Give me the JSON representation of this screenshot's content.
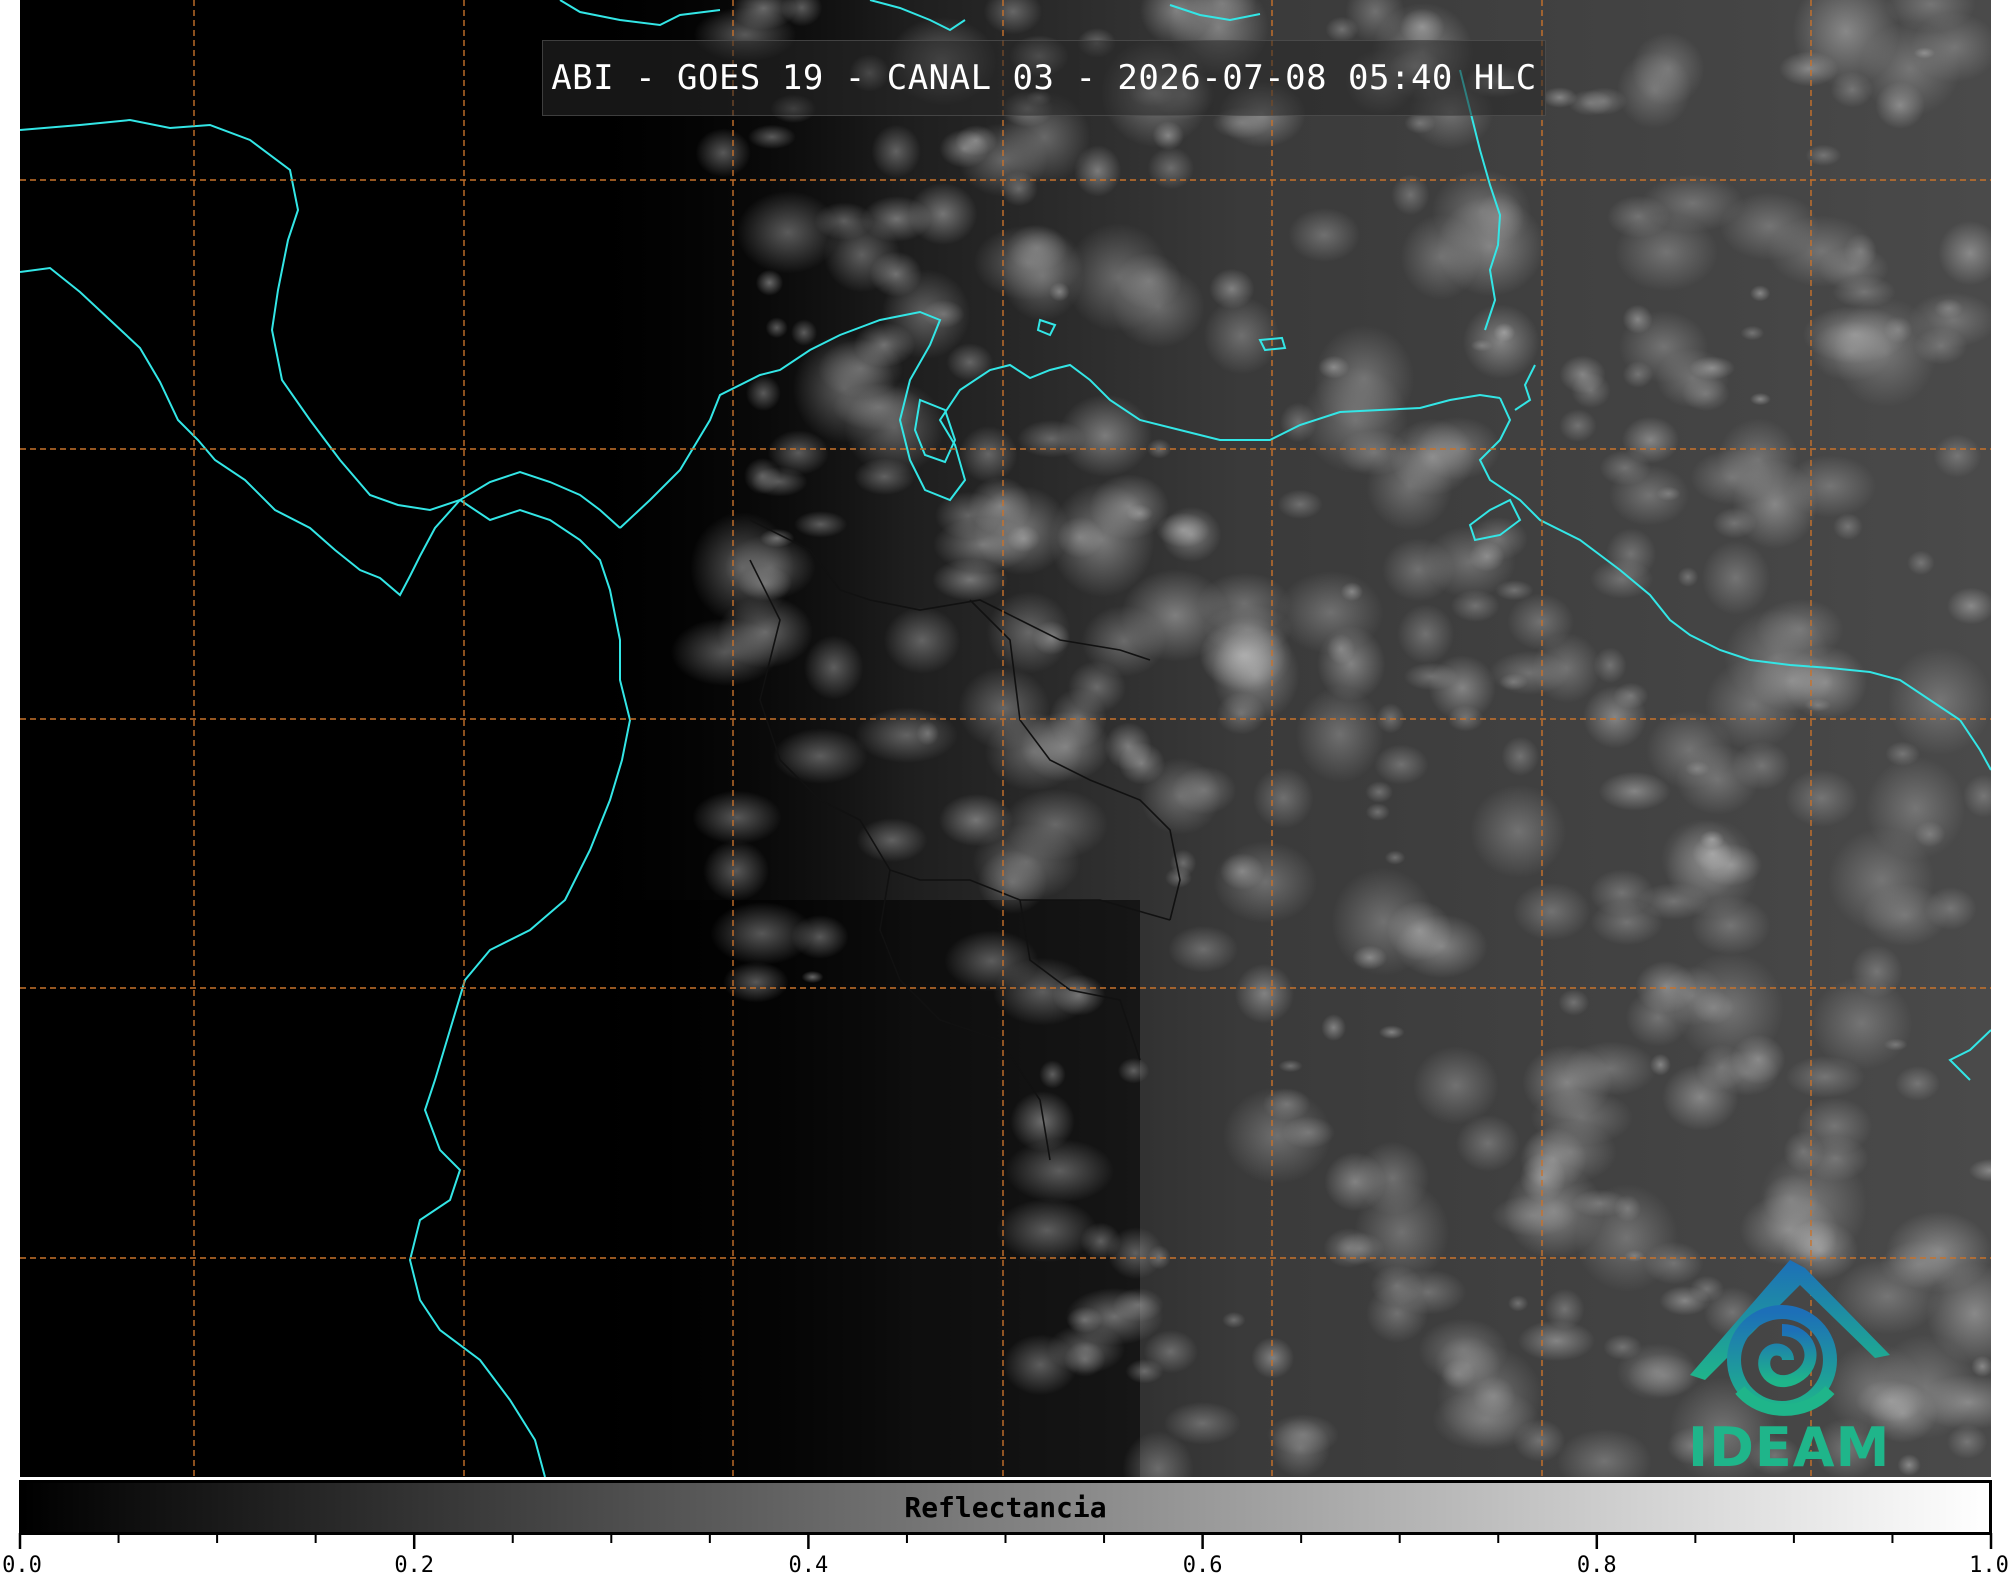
{
  "title": "ABI - GOES 19 - CANAL 03 - 2026-07-08 05:40 HLC",
  "logo": {
    "text": "IDEAM",
    "icon": "ideam-logo-icon"
  },
  "colorbar": {
    "label": "Reflectancia",
    "min": 0.0,
    "max": 1.0,
    "major_ticks": [
      "0.0",
      "0.2",
      "0.4",
      "0.6",
      "0.8",
      "1.0"
    ],
    "minor_step": 0.05,
    "colors": {
      "start": "#000000",
      "end": "#ffffff"
    }
  },
  "map": {
    "grid_color": "#c8722b",
    "coastline_color": "#33e6e6",
    "border_color": "#111111"
  }
}
